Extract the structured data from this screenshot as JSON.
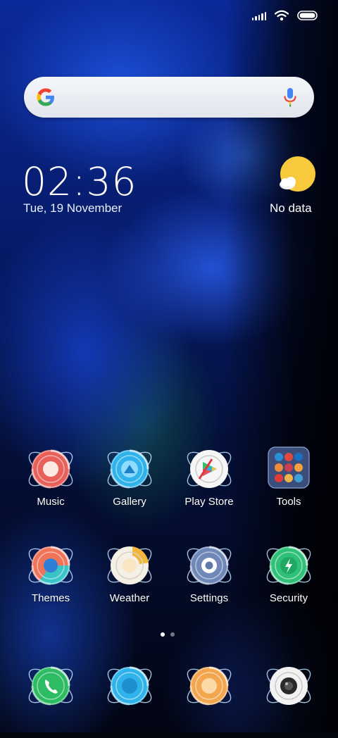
{
  "status_bar": {
    "signal_icon": "signal-bars-icon",
    "wifi_icon": "wifi-icon",
    "battery_icon": "battery-icon"
  },
  "search_bar": {
    "logo_icon": "google-g-icon",
    "mic_icon": "microphone-icon"
  },
  "clock_widget": {
    "time": "02:36",
    "date": "Tue, 19 November"
  },
  "weather_widget": {
    "icon": "partly-cloudy-icon",
    "text": "No data"
  },
  "apps_row1": [
    {
      "label": "Music",
      "icon": "music-icon",
      "color": "#e8605a"
    },
    {
      "label": "Gallery",
      "icon": "gallery-icon",
      "color": "#2fb3ea"
    },
    {
      "label": "Play Store",
      "icon": "play-store-icon",
      "color": "#f6f6f6"
    },
    {
      "label": "Tools",
      "icon": "tools-folder-icon",
      "color": "#3b4d7a"
    }
  ],
  "apps_row2": [
    {
      "label": "Themes",
      "icon": "themes-icon",
      "color": "#f0745a"
    },
    {
      "label": "Weather",
      "icon": "weather-app-icon",
      "color": "#f4f0e6"
    },
    {
      "label": "Settings",
      "icon": "settings-icon",
      "color": "#8aa0c6"
    },
    {
      "label": "Security",
      "icon": "security-icon",
      "color": "#2fc07a"
    }
  ],
  "dock": [
    {
      "icon": "phone-icon",
      "color": "#2dbb63"
    },
    {
      "icon": "messages-icon",
      "color": "#2fb3ea"
    },
    {
      "icon": "browser-icon",
      "color": "#f2a64e"
    },
    {
      "icon": "camera-icon",
      "color": "#f2f2f2"
    }
  ],
  "page_indicator": {
    "pages": 2,
    "active": 1
  }
}
